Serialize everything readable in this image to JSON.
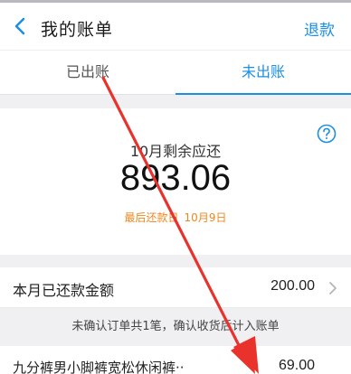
{
  "nav": {
    "title": "我的账单",
    "action_label": "退款"
  },
  "tabs": [
    {
      "label": "已出账",
      "active": false
    },
    {
      "label": "未出账",
      "active": true
    }
  ],
  "summary": {
    "due_label": "10月剩余应还",
    "due_amount": "893.06",
    "due_date_prefix": "最后还款日",
    "due_date_value": "10月9日"
  },
  "paid_row": {
    "label": "本月已还款金额",
    "amount": "200.00"
  },
  "notice": {
    "text": "未确认订单共1笔，确认收货后计入账单"
  },
  "order": {
    "name": "九分裤男小脚裤宽松休闲裤··",
    "price": "69.00"
  },
  "colors": {
    "accent": "#1a8fe3",
    "warning": "#f0861e",
    "annotation": "#e8322b"
  },
  "icons": {
    "back": "chevron-left-icon",
    "help": "question-circle-icon",
    "chevron": "chevron-right-icon"
  }
}
